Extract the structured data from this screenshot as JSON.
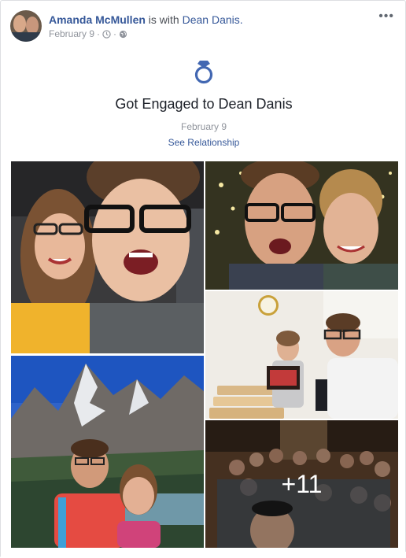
{
  "post": {
    "author": "Amanda McMullen",
    "with_text": "is with",
    "tagged": "Dean Danis.",
    "date": "February 9",
    "separator": "·",
    "more_icon": "ellipsis-icon",
    "privacy_icon": "globe-icon",
    "clock_icon": "clock-icon"
  },
  "event": {
    "icon": "ring-icon",
    "title": "Got Engaged to Dean Danis",
    "date": "February 9",
    "link": "See Relationship"
  },
  "photos": {
    "more_count": "+11",
    "accent": "#365899"
  }
}
